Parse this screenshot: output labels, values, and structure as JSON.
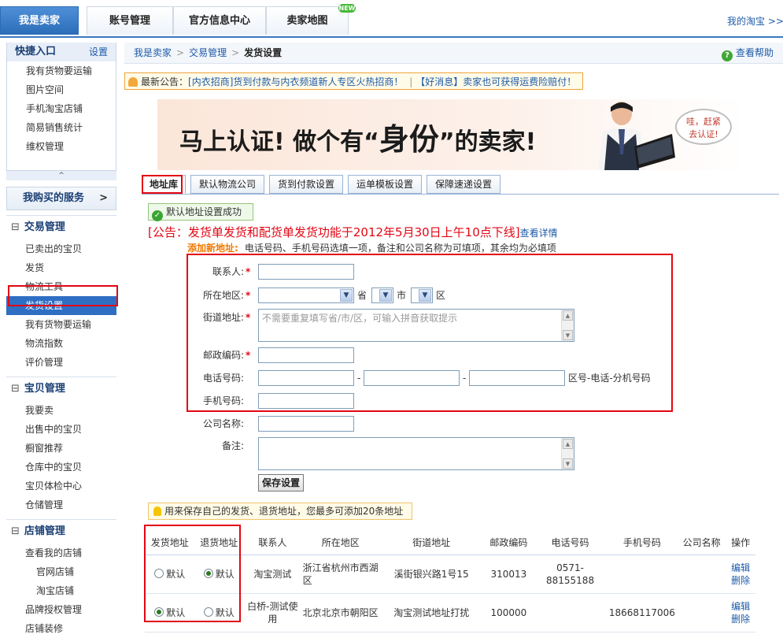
{
  "topnav": {
    "tabs": [
      "我是卖家",
      "账号管理",
      "官方信息中心",
      "卖家地图"
    ],
    "new_badge": "NEW",
    "my_taobao": "我的淘宝 >>"
  },
  "sidebar": {
    "quick": {
      "title": "快捷入口",
      "setting": "设置",
      "items": [
        "我有货物要运输",
        "图片空间",
        "手机淘宝店铺",
        "简易销售统计",
        "维权管理"
      ],
      "toggle": "^"
    },
    "service": {
      "label": "我购买的服务",
      "arrow": ">"
    },
    "groups": [
      {
        "title": "交易管理",
        "items": [
          "已卖出的宝贝",
          "发货",
          "物流工具",
          "发货设置",
          "我有货物要运输",
          "物流指数",
          "评价管理"
        ]
      },
      {
        "title": "宝贝管理",
        "items": [
          "我要卖",
          "出售中的宝贝",
          "橱窗推荐",
          "仓库中的宝贝",
          "宝贝体检中心",
          "仓储管理"
        ]
      },
      {
        "title": "店铺管理",
        "items": [
          "查看我的店铺",
          "官网店铺",
          "淘宝店铺",
          "品牌授权管理",
          "店铺装修"
        ]
      }
    ],
    "minus": "⊟"
  },
  "breadcrumb": {
    "items": [
      "我是卖家",
      "交易管理"
    ],
    "sep": ">",
    "current": "发货设置",
    "help": "查看帮助",
    "help_icon": "?"
  },
  "notice": {
    "prefix": "最新公告：",
    "link1": "[内衣招商]货到付款与内衣频道新人专区火热招商！",
    "divider": "|",
    "link2": "【好消息】卖家也可获得运费险赔付！"
  },
  "banner": {
    "part1": "马上认证! 做个有",
    "open_quote": "“",
    "big": "身份",
    "close_quote": "”",
    "part2": "的卖家!",
    "bubble_line1": "哇，赶紧",
    "bubble_line2": "去认证!"
  },
  "tabs": [
    "地址库",
    "默认物流公司",
    "货到付款设置",
    "运单模板设置",
    "保障速递设置"
  ],
  "success_msg": "默认地址设置成功",
  "announce": {
    "text": "[公告：发货单发货和配货单发货功能于2012年5月30日上午10点下线]",
    "detail": "查看详情"
  },
  "add_address": {
    "label": "添加新地址:",
    "hint": "电话号码、手机号码选填一项，备注和公司名称为可填项，其余均为必填项"
  },
  "form": {
    "required_mark": "*",
    "contact_label": "联系人:",
    "region_label": "所在地区:",
    "province_unit": "省",
    "city_unit": "市",
    "district_unit": "区",
    "street_label": "街道地址:",
    "street_placeholder": "不需要重复填写省/市/区，可输入拼音获取提示",
    "postcode_label": "邮政编码:",
    "phone_label": "电话号码:",
    "phone_dash": "-",
    "phone_hint": "区号-电话-分机号码",
    "mobile_label": "手机号码:",
    "company_label": "公司名称:",
    "remark_label": "备注:",
    "save": "保存设置"
  },
  "tip": "用来保存自己的发货、退货地址，您最多可添加20条地址",
  "table": {
    "headers": [
      "发货地址",
      "退货地址",
      "联系人",
      "所在地区",
      "街道地址",
      "邮政编码",
      "电话号码",
      "手机号码",
      "公司名称",
      "操作"
    ],
    "radio_label": "默认",
    "edit": "编辑",
    "delete": "删除",
    "rows": [
      {
        "ship_default": false,
        "return_default": true,
        "contact": "淘宝测试",
        "region": "浙江省杭州市西湖区",
        "street": "溪街银兴路1号15",
        "postcode": "310013",
        "phone": "0571-88155188",
        "mobile": "",
        "company": ""
      },
      {
        "ship_default": true,
        "return_default": false,
        "contact": "白桥-测试使用",
        "region": "北京北京市朝阳区",
        "street": "淘宝测试地址打扰",
        "postcode": "100000",
        "phone": "",
        "mobile": "18668117006",
        "company": ""
      }
    ]
  },
  "colors": {
    "accent": "#2e6fc4",
    "highlight_box": "#e30613",
    "announce": "#e30613",
    "add_label": "#f07800",
    "success_bg": "#eff9e9"
  }
}
